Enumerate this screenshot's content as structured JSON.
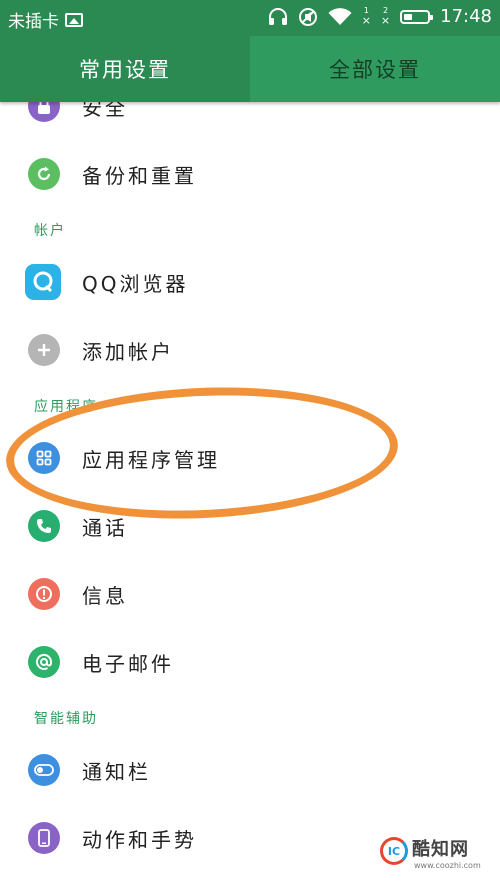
{
  "status_bar": {
    "carrier_text": "未插卡",
    "sim1_label": "1",
    "sim2_label": "2",
    "sim_no_signal": "×",
    "time": "17:48",
    "icons": [
      "image-icon",
      "headphones-icon",
      "mute-icon",
      "wifi-icon",
      "sim-no-signal-icon",
      "battery-icon"
    ]
  },
  "tabs": [
    {
      "label": "常用设置",
      "active": true
    },
    {
      "label": "全部设置",
      "active": false
    }
  ],
  "list": {
    "security": {
      "label": "安全",
      "icon": "lock-icon",
      "color": "#8a63c7"
    },
    "backup": {
      "label": "备份和重置",
      "icon": "refresh-icon",
      "color": "#5bbf62"
    },
    "section_accounts": "帐户",
    "qq_browser": {
      "label": "QQ浏览器",
      "icon": "qq-browser-icon",
      "color": "#2bb3e8"
    },
    "add_account": {
      "label": "添加帐户",
      "icon": "plus-icon",
      "color": "#b5b5b5"
    },
    "section_apps": "应用程序",
    "app_manager": {
      "label": "应用程序管理",
      "icon": "grid-icon",
      "color": "#3d8fe0"
    },
    "calls": {
      "label": "通话",
      "icon": "phone-icon",
      "color": "#27ae70"
    },
    "messages": {
      "label": "信息",
      "icon": "alert-icon",
      "color": "#ef6f5e"
    },
    "email": {
      "label": "电子邮件",
      "icon": "at-icon",
      "color": "#2db36b"
    },
    "section_assist": "智能辅助",
    "notification_bar": {
      "label": "通知栏",
      "icon": "toggle-icon",
      "color": "#3d8fe0"
    },
    "gestures": {
      "label": "动作和手势",
      "icon": "phone-device-icon",
      "color": "#8a63c7"
    }
  },
  "watermark": {
    "logo_text": "IC",
    "title": "酷知网",
    "url": "www.coozhi.com"
  },
  "annotation_color": "#f0923a"
}
